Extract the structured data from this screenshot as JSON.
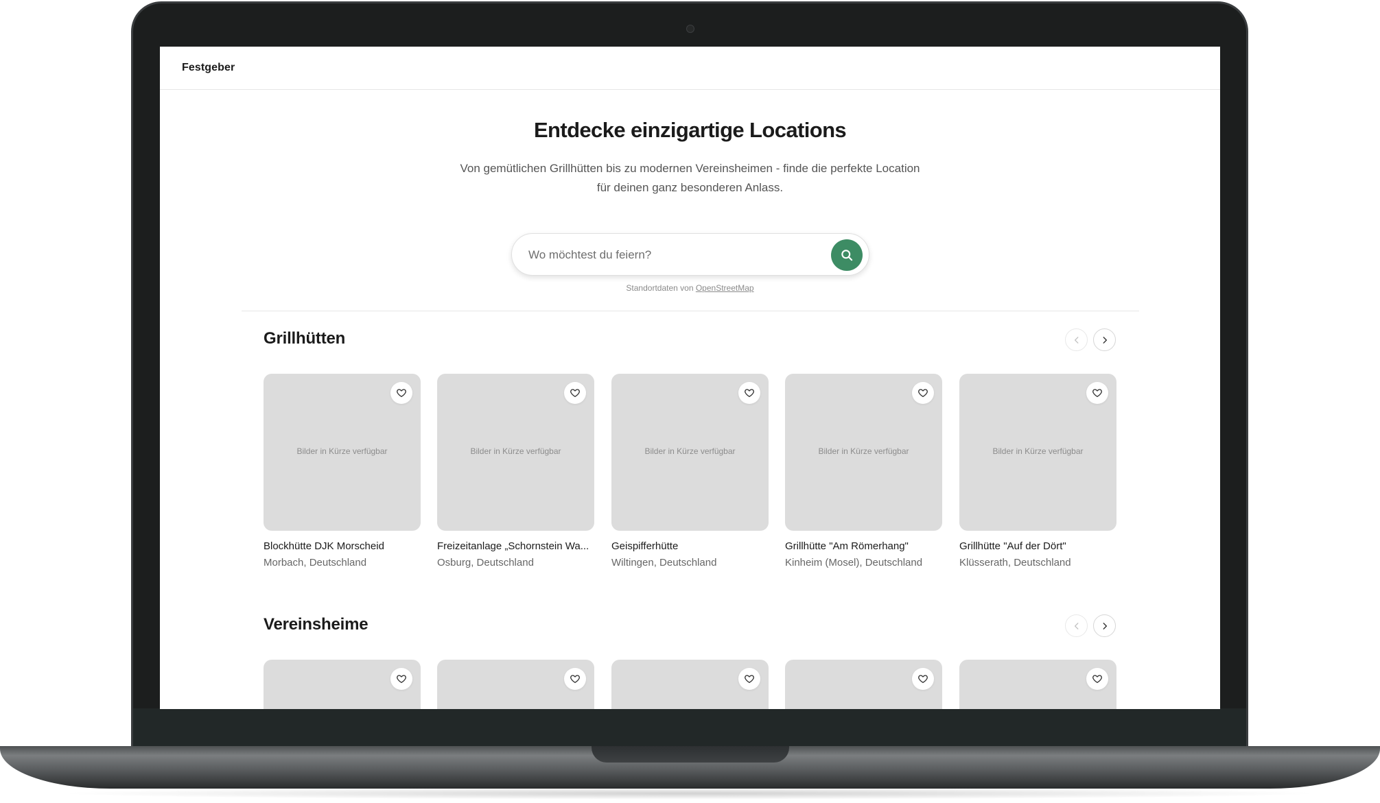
{
  "header": {
    "brand": "Festgeber"
  },
  "hero": {
    "title": "Entdecke einzigartige Locations",
    "subtitle_line1": "Von gemütlichen Grillhütten bis zu modernen Vereinsheimen - finde die perfekte Location",
    "subtitle_line2": "für deinen ganz besonderen Anlass."
  },
  "search": {
    "placeholder": "Wo möchtest du feiern?",
    "attribution_prefix": "Standortdaten von ",
    "attribution_link": "OpenStreetMap"
  },
  "sections": [
    {
      "title": "Grillhütten",
      "cards": [
        {
          "placeholder": "Bilder in Kürze verfügbar",
          "name": "Blockhütte DJK Morscheid",
          "location": "Morbach, Deutschland"
        },
        {
          "placeholder": "Bilder in Kürze verfügbar",
          "name": "Freizeitanlage „Schornstein Wa...",
          "location": "Osburg, Deutschland"
        },
        {
          "placeholder": "Bilder in Kürze verfügbar",
          "name": "Geispifferhütte",
          "location": "Wiltingen, Deutschland"
        },
        {
          "placeholder": "Bilder in Kürze verfügbar",
          "name": "Grillhütte \"Am Römerhang\"",
          "location": "Kinheim (Mosel), Deutschland"
        },
        {
          "placeholder": "Bilder in Kürze verfügbar",
          "name": "Grillhütte \"Auf der Dört\"",
          "location": "Klüsserath, Deutschland"
        }
      ]
    },
    {
      "title": "Vereinsheime"
    }
  ],
  "colors": {
    "accent": "#3d8c64",
    "placeholder_bg": "#dcdcdc"
  },
  "icons": {
    "search": "search-icon",
    "heart": "heart-icon",
    "prev": "chevron-left-icon",
    "next": "chevron-right-icon"
  }
}
